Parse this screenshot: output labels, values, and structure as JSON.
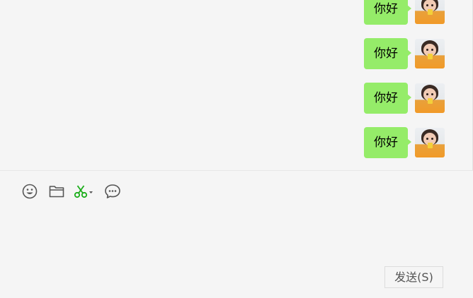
{
  "messages": [
    {
      "text": "你好",
      "sender": "self"
    },
    {
      "text": "你好",
      "sender": "self"
    },
    {
      "text": "你好",
      "sender": "self"
    },
    {
      "text": "你好",
      "sender": "self"
    }
  ],
  "toolbar": {
    "icons": [
      "emoji-icon",
      "folder-icon",
      "scissors-icon",
      "chat-bubble-icon"
    ]
  },
  "send_button": {
    "label": "发送(S)"
  },
  "colors": {
    "bubble": "#95ec69",
    "background": "#f5f5f5",
    "scissors": "#1aad19",
    "icon": "#555555"
  }
}
